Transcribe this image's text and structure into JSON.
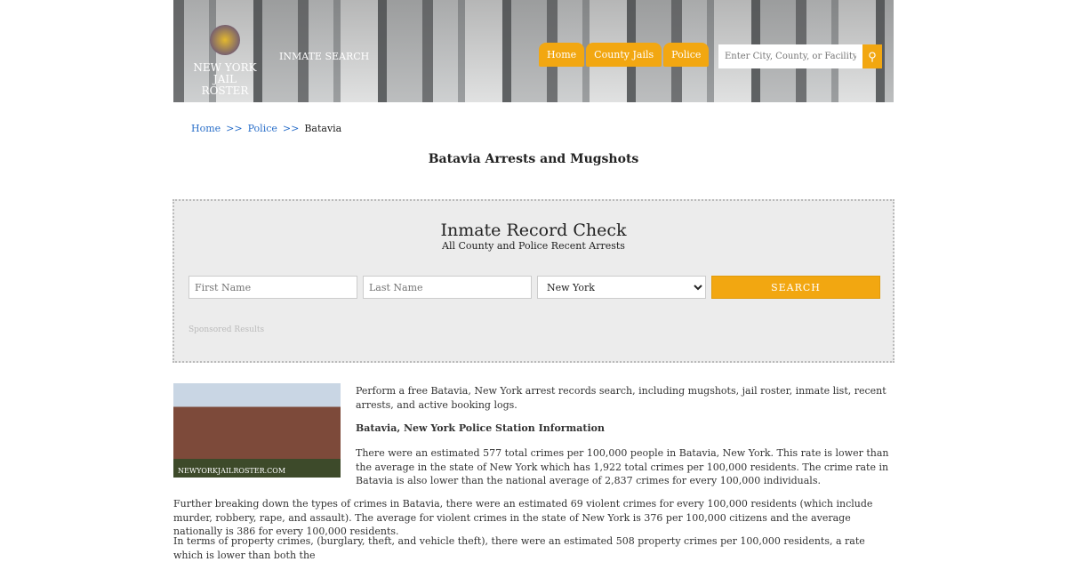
{
  "header": {
    "logo_line1": "NEW YORK",
    "logo_line2": "JAIL ROSTER",
    "inmate_search": "INMATE SEARCH",
    "nav": [
      "Home",
      "County Jails",
      "Police"
    ],
    "search_placeholder": "Enter City, County, or Facility",
    "accent": "#f2a711"
  },
  "breadcrumb": [
    "Home",
    "Police",
    "Batavia"
  ],
  "breadcrumb_sep": ">>",
  "page_title": "Batavia Arrests and Mugshots",
  "record_check": {
    "title": "Inmate Record Check",
    "subtitle": "All County and Police Recent Arrests",
    "first_placeholder": "First Name",
    "last_placeholder": "Last Name",
    "state": "New York",
    "search_label": "SEARCH",
    "sponsored": "Sponsored Results"
  },
  "photo_watermark": "NEWYORKJAILROSTER.COM",
  "content": {
    "intro": "Perform a free Batavia, New York arrest records search, including mugshots, jail roster, inmate list, recent arrests, and active booking logs.",
    "heading": "Batavia, New York Police Station Information",
    "p1": "There were an estimated 577 total crimes per 100,000 people in Batavia, New York. This rate is lower than the average in the state of New York which has 1,922 total crimes per 100,000 residents. The crime rate in Batavia is also lower than the national average of 2,837 crimes for every 100,000 individuals.",
    "p2": "Further breaking down the types of crimes in Batavia, there were an estimated 69 violent crimes for every 100,000 residents (which include murder, robbery, rape, and assault). The average for violent crimes in the state of New York is 376 per 100,000 citizens and the average nationally is 386 for every 100,000 residents.",
    "p3": "In terms of property crimes, (burglary, theft, and vehicle theft), there were an estimated 508 property crimes per 100,000 residents, a rate which is lower than both the"
  }
}
